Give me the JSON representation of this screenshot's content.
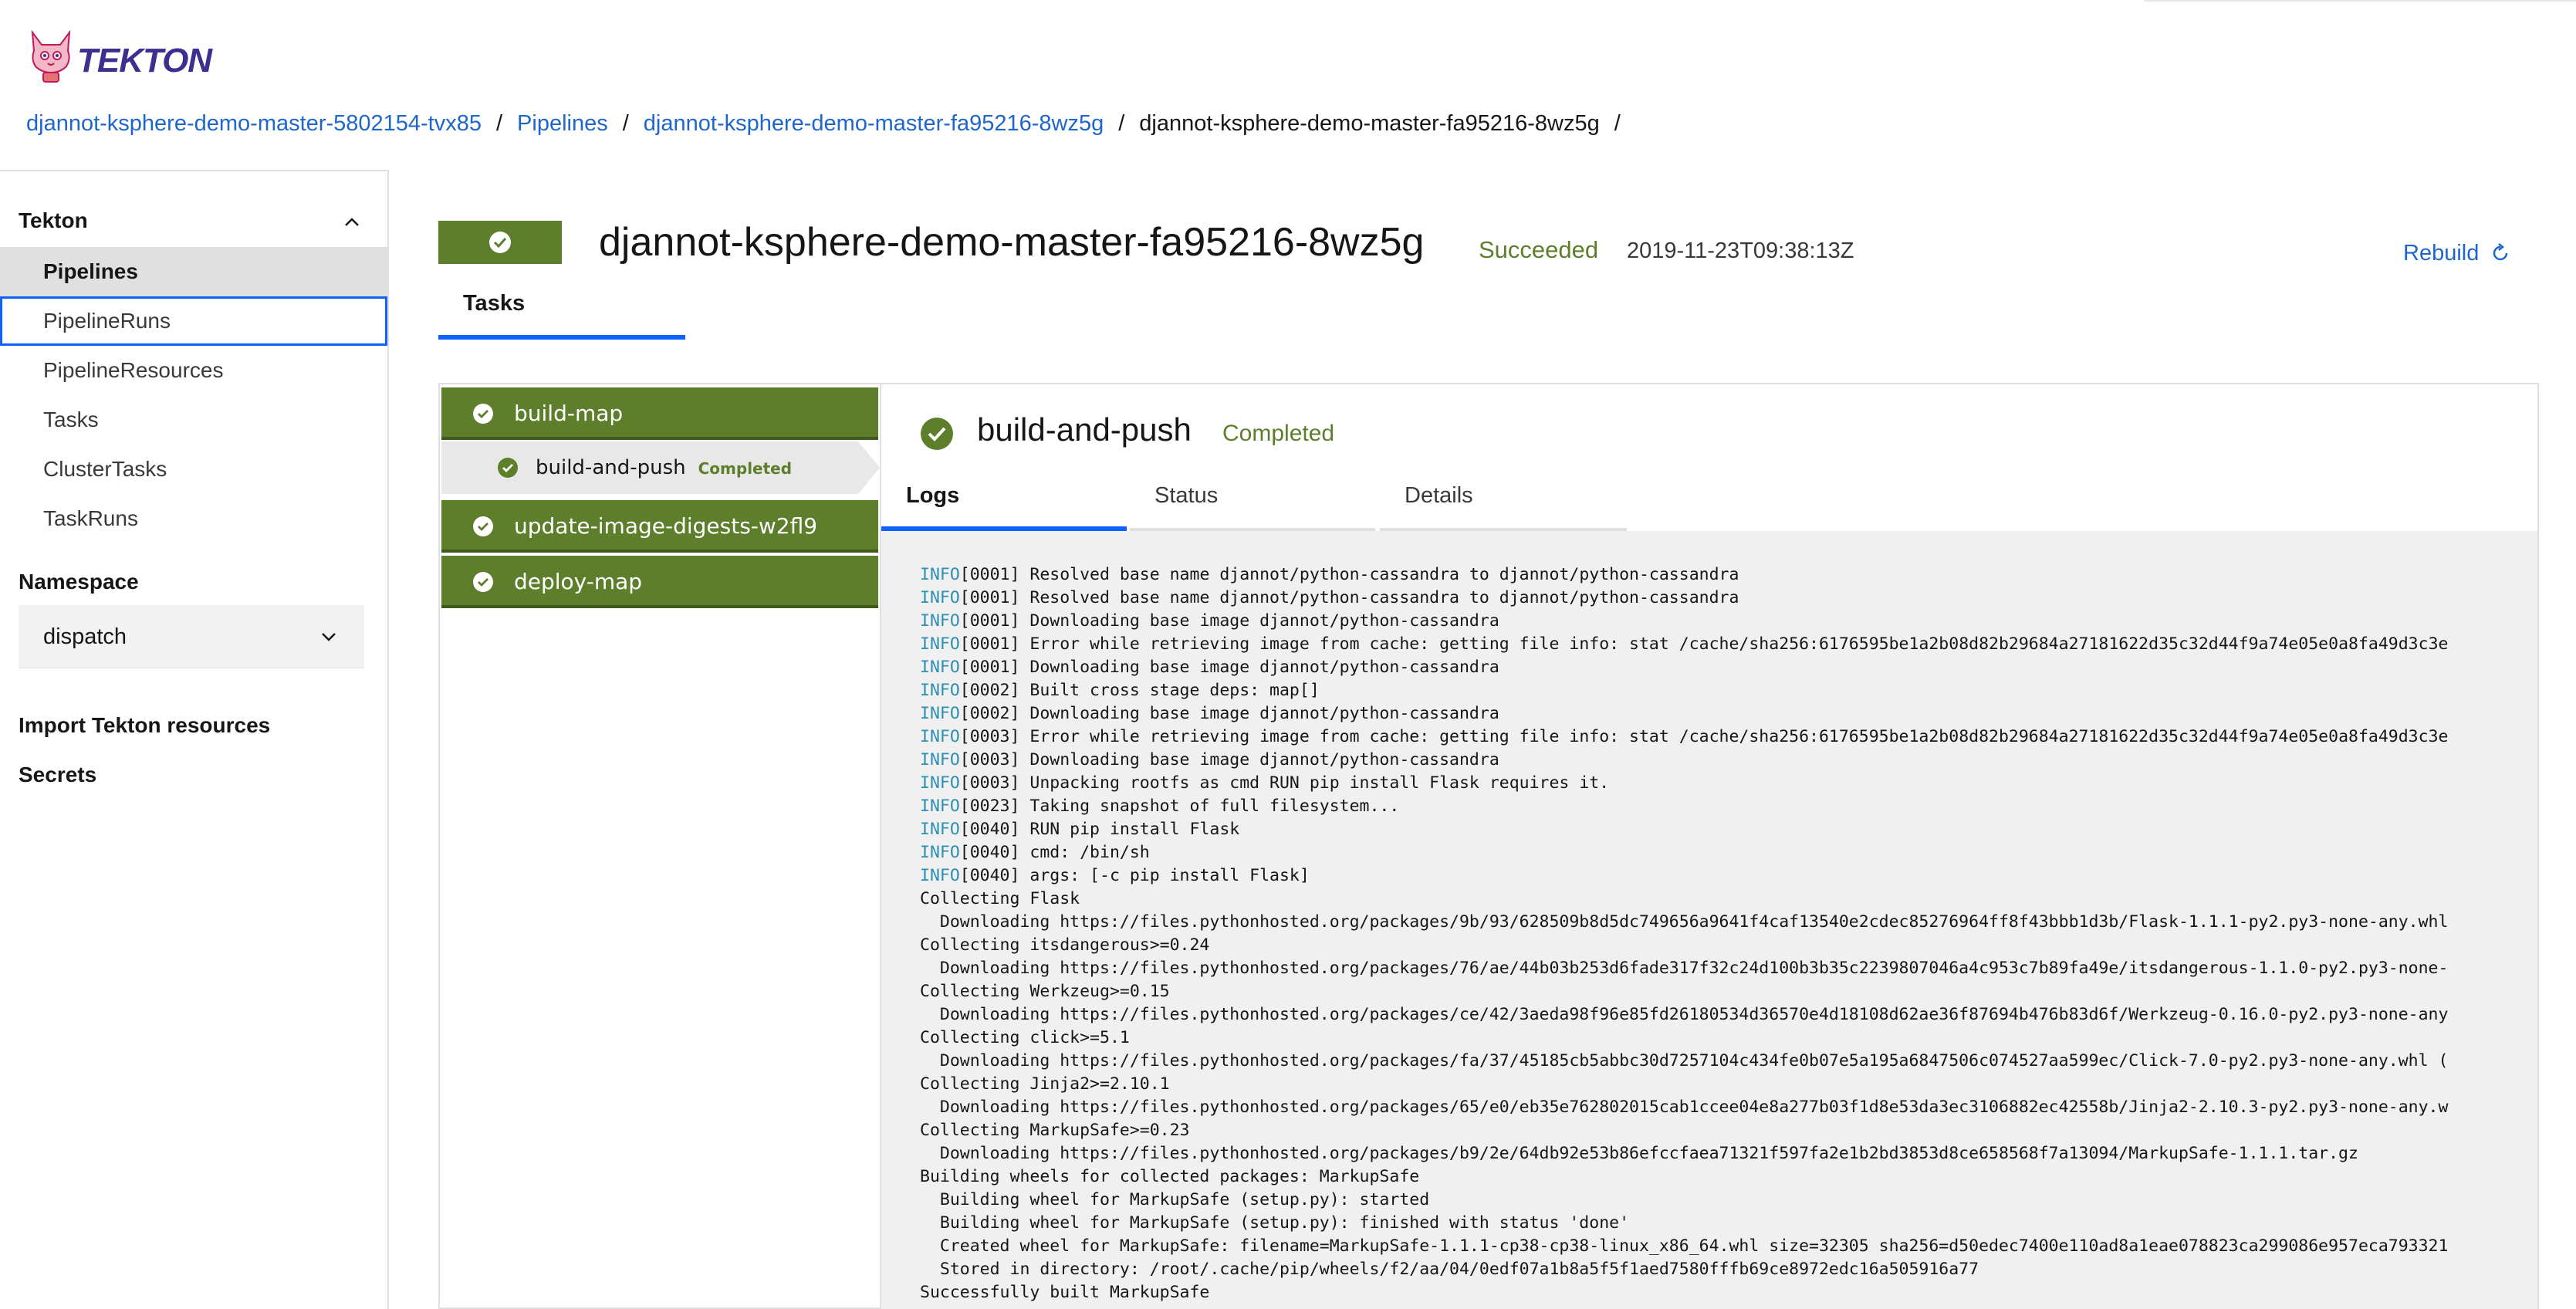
{
  "header": {
    "logo_text": "TEKTON",
    "breadcrumb": [
      {
        "label": "djannot-ksphere-demo-master-5802154-tvx85",
        "link": true
      },
      {
        "label": "Pipelines",
        "link": true
      },
      {
        "label": "djannot-ksphere-demo-master-fa95216-8wz5g",
        "link": true
      },
      {
        "label": "djannot-ksphere-demo-master-fa95216-8wz5g",
        "link": false
      }
    ],
    "separator": "/"
  },
  "sidebar": {
    "section_tekton": "Tekton",
    "items": [
      {
        "label": "Pipelines",
        "state": "active"
      },
      {
        "label": "PipelineRuns",
        "state": "focus"
      },
      {
        "label": "PipelineResources",
        "state": ""
      },
      {
        "label": "Tasks",
        "state": ""
      },
      {
        "label": "ClusterTasks",
        "state": ""
      },
      {
        "label": "TaskRuns",
        "state": ""
      }
    ],
    "section_namespace": "Namespace",
    "namespace_value": "dispatch",
    "import_label": "Import Tekton resources",
    "secrets_label": "Secrets"
  },
  "run": {
    "title": "djannot-ksphere-demo-master-fa95216-8wz5g",
    "status": "Succeeded",
    "timestamp": "2019-11-23T09:38:13Z",
    "rebuild_label": "Rebuild",
    "tab_label": "Tasks"
  },
  "tasks": [
    {
      "label": "build-map"
    },
    {
      "label": "update-image-digests-w2fl9"
    },
    {
      "label": "deploy-map"
    }
  ],
  "step": {
    "label": "build-and-push",
    "badge": "Completed",
    "title": "build-and-push",
    "status": "Completed",
    "tabs": [
      "Logs",
      "Status",
      "Details"
    ]
  },
  "colors": {
    "success": "#5d7f2c",
    "link": "#1f66cc",
    "accent": "#0f62fe",
    "log_level": "#2d8fb3"
  },
  "logs": [
    {
      "level": "INFO",
      "text": "[0001] Resolved base name djannot/python-cassandra to djannot/python-cassandra"
    },
    {
      "level": "INFO",
      "text": "[0001] Resolved base name djannot/python-cassandra to djannot/python-cassandra"
    },
    {
      "level": "INFO",
      "text": "[0001] Downloading base image djannot/python-cassandra"
    },
    {
      "level": "INFO",
      "text": "[0001] Error while retrieving image from cache: getting file info: stat /cache/sha256:6176595be1a2b08d82b29684a27181622d35c32d44f9a74e05e0a8fa49d3c3e"
    },
    {
      "level": "INFO",
      "text": "[0001] Downloading base image djannot/python-cassandra"
    },
    {
      "level": "INFO",
      "text": "[0002] Built cross stage deps: map[]"
    },
    {
      "level": "INFO",
      "text": "[0002] Downloading base image djannot/python-cassandra"
    },
    {
      "level": "INFO",
      "text": "[0003] Error while retrieving image from cache: getting file info: stat /cache/sha256:6176595be1a2b08d82b29684a27181622d35c32d44f9a74e05e0a8fa49d3c3e"
    },
    {
      "level": "INFO",
      "text": "[0003] Downloading base image djannot/python-cassandra"
    },
    {
      "level": "INFO",
      "text": "[0003] Unpacking rootfs as cmd RUN pip install Flask requires it."
    },
    {
      "level": "INFO",
      "text": "[0023] Taking snapshot of full filesystem..."
    },
    {
      "level": "INFO",
      "text": "[0040] RUN pip install Flask"
    },
    {
      "level": "INFO",
      "text": "[0040] cmd: /bin/sh"
    },
    {
      "level": "INFO",
      "text": "[0040] args: [-c pip install Flask]"
    },
    {
      "level": "",
      "text": "Collecting Flask"
    },
    {
      "level": "",
      "text": "  Downloading https://files.pythonhosted.org/packages/9b/93/628509b8d5dc749656a9641f4caf13540e2cdec85276964ff8f43bbb1d3b/Flask-1.1.1-py2.py3-none-any.whl"
    },
    {
      "level": "",
      "text": "Collecting itsdangerous>=0.24"
    },
    {
      "level": "",
      "text": "  Downloading https://files.pythonhosted.org/packages/76/ae/44b03b253d6fade317f32c24d100b3b35c2239807046a4c953c7b89fa49e/itsdangerous-1.1.0-py2.py3-none-"
    },
    {
      "level": "",
      "text": "Collecting Werkzeug>=0.15"
    },
    {
      "level": "",
      "text": "  Downloading https://files.pythonhosted.org/packages/ce/42/3aeda98f96e85fd26180534d36570e4d18108d62ae36f87694b476b83d6f/Werkzeug-0.16.0-py2.py3-none-any"
    },
    {
      "level": "",
      "text": "Collecting click>=5.1"
    },
    {
      "level": "",
      "text": "  Downloading https://files.pythonhosted.org/packages/fa/37/45185cb5abbc30d7257104c434fe0b07e5a195a6847506c074527aa599ec/Click-7.0-py2.py3-none-any.whl ("
    },
    {
      "level": "",
      "text": "Collecting Jinja2>=2.10.1"
    },
    {
      "level": "",
      "text": "  Downloading https://files.pythonhosted.org/packages/65/e0/eb35e762802015cab1ccee04e8a277b03f1d8e53da3ec3106882ec42558b/Jinja2-2.10.3-py2.py3-none-any.w"
    },
    {
      "level": "",
      "text": "Collecting MarkupSafe>=0.23"
    },
    {
      "level": "",
      "text": "  Downloading https://files.pythonhosted.org/packages/b9/2e/64db92e53b86efccfaea71321f597fa2e1b2bd3853d8ce658568f7a13094/MarkupSafe-1.1.1.tar.gz"
    },
    {
      "level": "",
      "text": "Building wheels for collected packages: MarkupSafe"
    },
    {
      "level": "",
      "text": "  Building wheel for MarkupSafe (setup.py): started"
    },
    {
      "level": "",
      "text": "  Building wheel for MarkupSafe (setup.py): finished with status 'done'"
    },
    {
      "level": "",
      "text": "  Created wheel for MarkupSafe: filename=MarkupSafe-1.1.1-cp38-cp38-linux_x86_64.whl size=32305 sha256=d50edec7400e110ad8a1eae078823ca299086e957eca793321"
    },
    {
      "level": "",
      "text": "  Stored in directory: /root/.cache/pip/wheels/f2/aa/04/0edf07a1b8a5f5f1aed7580fffb69ce8972edc16a505916a77"
    },
    {
      "level": "",
      "text": "Successfully built MarkupSafe"
    }
  ]
}
